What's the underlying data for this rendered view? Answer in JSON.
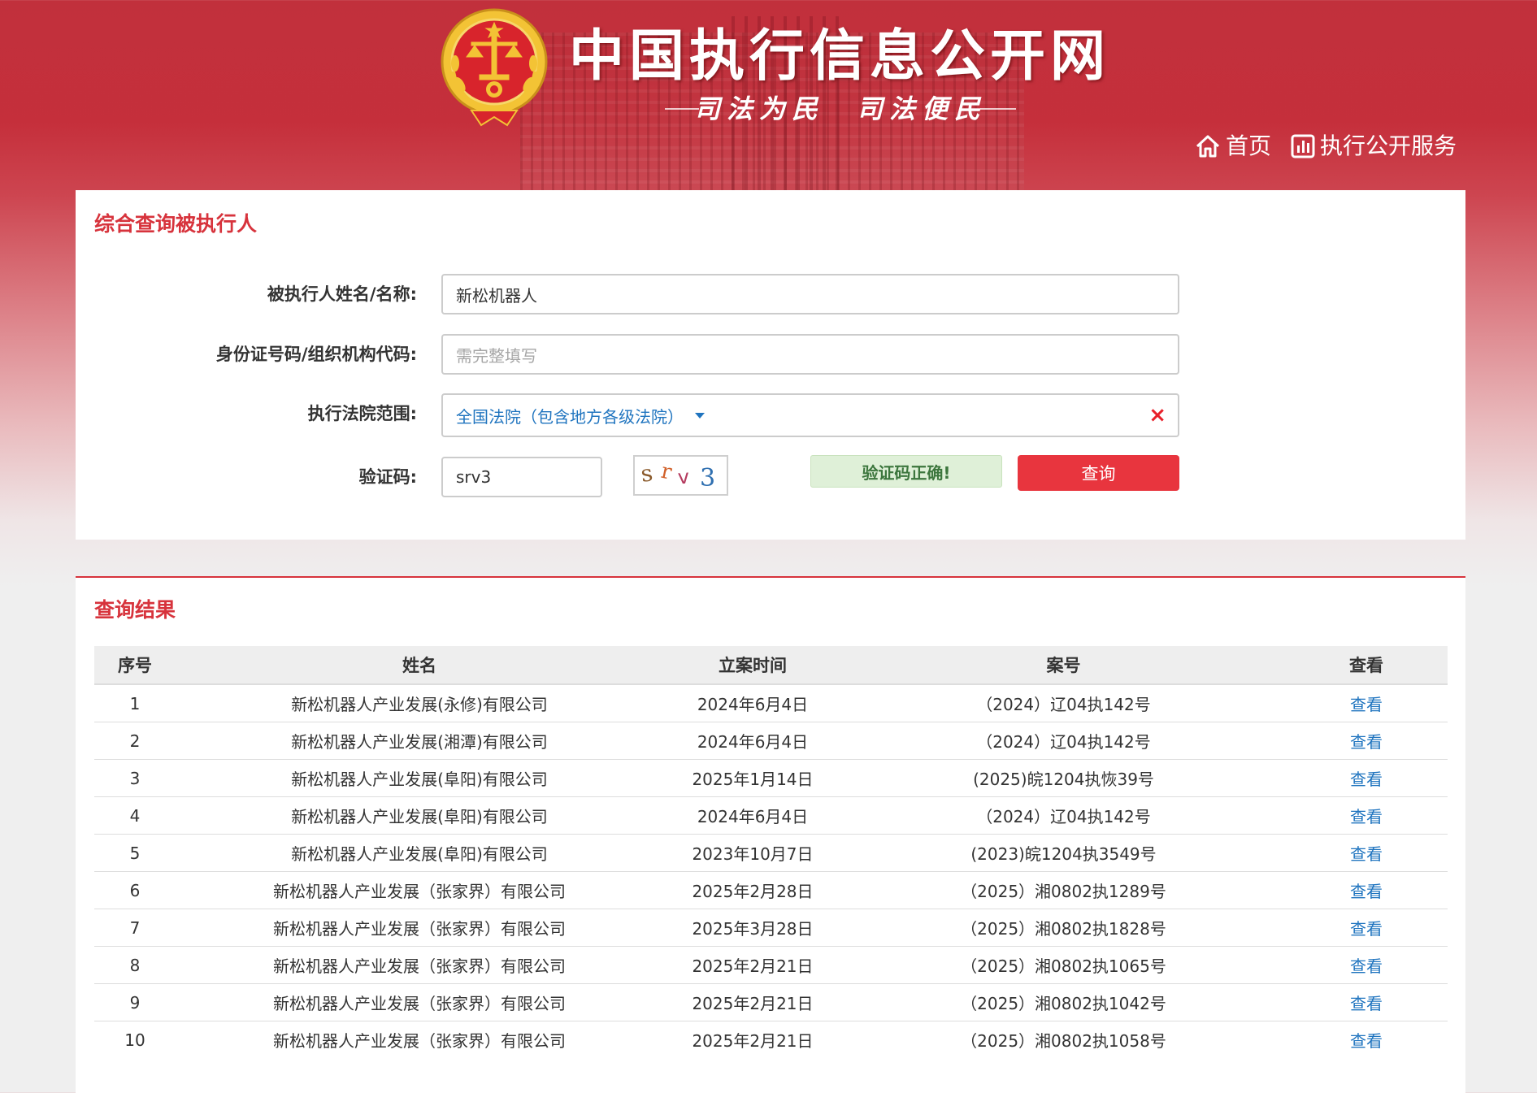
{
  "header": {
    "site_title": "中国执行信息公开网",
    "slogan": "司法为民　司法便民",
    "nav": {
      "home_label": "首页",
      "service_label": "执行公开服务"
    }
  },
  "search": {
    "title": "综合查询被执行人",
    "name_label": "被执行人姓名/名称:",
    "name_value": "新松机器人",
    "id_label": "身份证号码/组织机构代码:",
    "id_placeholder": "需完整填写",
    "court_label": "执行法院范围:",
    "court_value": "全国法院（包含地方各级法院）",
    "court_clear": "×",
    "captcha_label": "验证码:",
    "captcha_value": "srv3",
    "captcha_image_text": "srv3",
    "captcha_status": "验证码正确!",
    "query_button": "查询"
  },
  "results": {
    "title": "查询结果",
    "columns": [
      "序号",
      "姓名",
      "立案时间",
      "案号",
      "查看"
    ],
    "rows": [
      {
        "no": "1",
        "name": "新松机器人产业发展(永修)有限公司",
        "date": "2024年6月4日",
        "case": "（2024）辽04执142号",
        "view": "查看"
      },
      {
        "no": "2",
        "name": "新松机器人产业发展(湘潭)有限公司",
        "date": "2024年6月4日",
        "case": "（2024）辽04执142号",
        "view": "查看"
      },
      {
        "no": "3",
        "name": "新松机器人产业发展(阜阳)有限公司",
        "date": "2025年1月14日",
        "case": "(2025)皖1204执恢39号",
        "view": "查看"
      },
      {
        "no": "4",
        "name": "新松机器人产业发展(阜阳)有限公司",
        "date": "2024年6月4日",
        "case": "（2024）辽04执142号",
        "view": "查看"
      },
      {
        "no": "5",
        "name": "新松机器人产业发展(阜阳)有限公司",
        "date": "2023年10月7日",
        "case": "(2023)皖1204执3549号",
        "view": "查看"
      },
      {
        "no": "6",
        "name": "新松机器人产业发展（张家界）有限公司",
        "date": "2025年2月28日",
        "case": "（2025）湘0802执1289号",
        "view": "查看"
      },
      {
        "no": "7",
        "name": "新松机器人产业发展（张家界）有限公司",
        "date": "2025年3月28日",
        "case": "（2025）湘0802执1828号",
        "view": "查看"
      },
      {
        "no": "8",
        "name": "新松机器人产业发展（张家界）有限公司",
        "date": "2025年2月21日",
        "case": "（2025）湘0802执1065号",
        "view": "查看"
      },
      {
        "no": "9",
        "name": "新松机器人产业发展（张家界）有限公司",
        "date": "2025年2月21日",
        "case": "（2025）湘0802执1042号",
        "view": "查看"
      },
      {
        "no": "10",
        "name": "新松机器人产业发展（张家界）有限公司",
        "date": "2025年2月21日",
        "case": "（2025）湘0802执1058号",
        "view": "查看"
      }
    ]
  },
  "colors": {
    "brand_red": "#c52f3b",
    "accent_red": "#d7333c",
    "button_red": "#e8353e",
    "link_blue": "#1f74bf",
    "success_green": "#3c763d"
  },
  "icons": {
    "logo": "court-emblem-icon",
    "home": "home-icon",
    "service": "chart-icon",
    "clear": "close-icon",
    "dropdown": "caret-down-icon"
  }
}
